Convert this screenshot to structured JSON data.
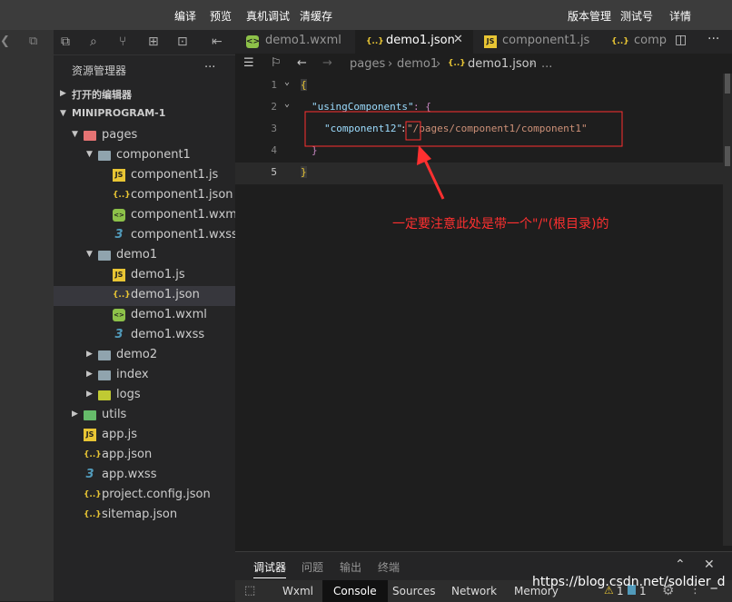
{
  "topbar": {
    "compile": "编译",
    "preview": "预览",
    "real_debug": "真机调试",
    "clear_cache": "清缓存",
    "version_mgmt": "版本管理",
    "test_account": "测试号",
    "details": "详情"
  },
  "sidebar": {
    "explorer_title": "资源管理器",
    "more": "···",
    "open_editors": "打开的编辑器",
    "project": "MINIPROGRAM-1",
    "items": [
      {
        "label": "pages",
        "kind": "folder-red",
        "depth": 1,
        "expanded": true
      },
      {
        "label": "component1",
        "kind": "folder",
        "depth": 2,
        "expanded": true
      },
      {
        "label": "component1.js",
        "kind": "js",
        "depth": 3
      },
      {
        "label": "component1.json",
        "kind": "json",
        "depth": 3
      },
      {
        "label": "component1.wxml",
        "kind": "wxml",
        "depth": 3
      },
      {
        "label": "component1.wxss",
        "kind": "wxss",
        "depth": 3
      },
      {
        "label": "demo1",
        "kind": "folder",
        "depth": 2,
        "expanded": true
      },
      {
        "label": "demo1.js",
        "kind": "js",
        "depth": 3
      },
      {
        "label": "demo1.json",
        "kind": "json",
        "depth": 3,
        "selected": true
      },
      {
        "label": "demo1.wxml",
        "kind": "wxml",
        "depth": 3
      },
      {
        "label": "demo1.wxss",
        "kind": "wxss",
        "depth": 3
      },
      {
        "label": "demo2",
        "kind": "folder",
        "depth": 2,
        "expanded": false
      },
      {
        "label": "index",
        "kind": "folder",
        "depth": 2,
        "expanded": false
      },
      {
        "label": "logs",
        "kind": "folder-yellow",
        "depth": 2,
        "expanded": false
      },
      {
        "label": "utils",
        "kind": "folder-green",
        "depth": 1,
        "expanded": false
      },
      {
        "label": "app.js",
        "kind": "js",
        "depth": 1
      },
      {
        "label": "app.json",
        "kind": "json",
        "depth": 1
      },
      {
        "label": "app.wxss",
        "kind": "wxss",
        "depth": 1
      },
      {
        "label": "project.config.json",
        "kind": "json",
        "depth": 1
      },
      {
        "label": "sitemap.json",
        "kind": "json",
        "depth": 1
      }
    ]
  },
  "tabs": [
    {
      "label": "demo1.wxml",
      "kind": "wxml"
    },
    {
      "label": "demo1.json",
      "kind": "json",
      "active": true
    },
    {
      "label": "component1.js",
      "kind": "js"
    },
    {
      "label": "comp",
      "kind": "json"
    }
  ],
  "breadcrumb": {
    "pages": "pages",
    "demo1": "demo1",
    "file": "demo1.json"
  },
  "code": {
    "line_numbers": [
      "1",
      "2",
      "3",
      "4",
      "5"
    ],
    "l1": "{",
    "l2_key": "\"usingComponents\"",
    "l2_rest": ": {",
    "l3_key": "\"component12\"",
    "l3_colon": ":",
    "l3_value": "\"/pages/component1/component1\"",
    "l4": "}",
    "l5": "}"
  },
  "annotation": "一定要注意此处是带一个\"/\"(根目录)的",
  "panel": {
    "tabs": [
      "调试器",
      "问题",
      "输出",
      "终端"
    ],
    "subtabs": [
      "Wxml",
      "Console",
      "Sources",
      "Network",
      "Memory"
    ],
    "active_subtab": "Console",
    "warn_count": "1",
    "info_count": "1"
  },
  "watermark": "https://blog.csdn.net/soldier_d",
  "colors": {
    "js": "#e8c534",
    "json": "#e8c534",
    "wxml": "#8dc149",
    "wxss": "#519aba",
    "annotation": "#ff3030"
  }
}
